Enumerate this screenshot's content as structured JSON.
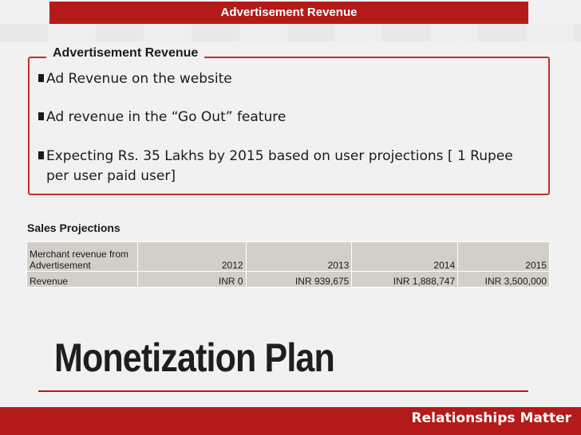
{
  "header": {
    "banner_title": "Advertisement Revenue"
  },
  "content_box": {
    "title": "Advertisement Revenue",
    "bullets": [
      {
        "text": "Ad Revenue on the website"
      },
      {
        "text": "Ad revenue in the “Go Out” feature"
      },
      {
        "line1": "Expecting Rs. 35 Lakhs by 2015 based on user projections [ 1 Rupee",
        "line2": "per user paid user]"
      }
    ]
  },
  "sales": {
    "label": "Sales Projections",
    "header": {
      "line1": "Merchant revenue from",
      "line2": "Advertisement",
      "years": [
        "2012",
        "2013",
        "2014",
        "2015"
      ]
    },
    "row": {
      "label": "Revenue",
      "values": [
        "INR 0",
        "INR 939,675",
        "INR 1,888,747",
        "INR 3,500,000"
      ]
    }
  },
  "slide_title": "Monetization Plan",
  "footer": {
    "tagline": "Relationships Matter"
  },
  "colors": {
    "accent": "#b51a1a",
    "table_cell": "#d1cfc8",
    "background": "#f1f1f1"
  }
}
